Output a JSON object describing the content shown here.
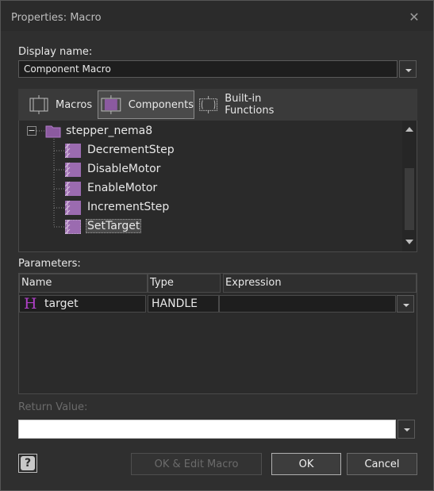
{
  "window": {
    "title": "Properties: Macro",
    "close_glyph": "✕"
  },
  "display_name": {
    "label": "Display name:",
    "value": "Component Macro"
  },
  "tabs": [
    {
      "label": "Macros",
      "icon": "macro-frame-icon",
      "active": false
    },
    {
      "label": "Components",
      "icon": "component-frame-icon",
      "active": true
    },
    {
      "label": "Built-in Functions",
      "icon": "builtin-function-icon",
      "active": false
    }
  ],
  "tree": {
    "root": {
      "label": "stepper_nema8",
      "expand_glyph": "−",
      "icon": "folder-icon"
    },
    "items": [
      {
        "label": "DecrementStep",
        "icon": "macro-icon"
      },
      {
        "label": "DisableMotor",
        "icon": "macro-icon"
      },
      {
        "label": "EnableMotor",
        "icon": "macro-icon"
      },
      {
        "label": "IncrementStep",
        "icon": "macro-icon"
      },
      {
        "label": "SetTarget",
        "icon": "macro-icon",
        "selected": true
      }
    ]
  },
  "parameters": {
    "label": "Parameters:",
    "columns": [
      "Name",
      "Type",
      "Expression"
    ],
    "rows": [
      {
        "icon_glyph": "H",
        "name": "target",
        "type": "HANDLE",
        "expression": ""
      }
    ]
  },
  "return_value": {
    "label": "Return Value:",
    "value": ""
  },
  "buttons": {
    "help_glyph": "?",
    "ok_edit": "OK & Edit Macro",
    "ok": "OK",
    "cancel": "Cancel"
  },
  "colors": {
    "accent": "#9e5fb0",
    "icon_purple": "#8b5aa0",
    "handle_purple": "#b040c8"
  }
}
